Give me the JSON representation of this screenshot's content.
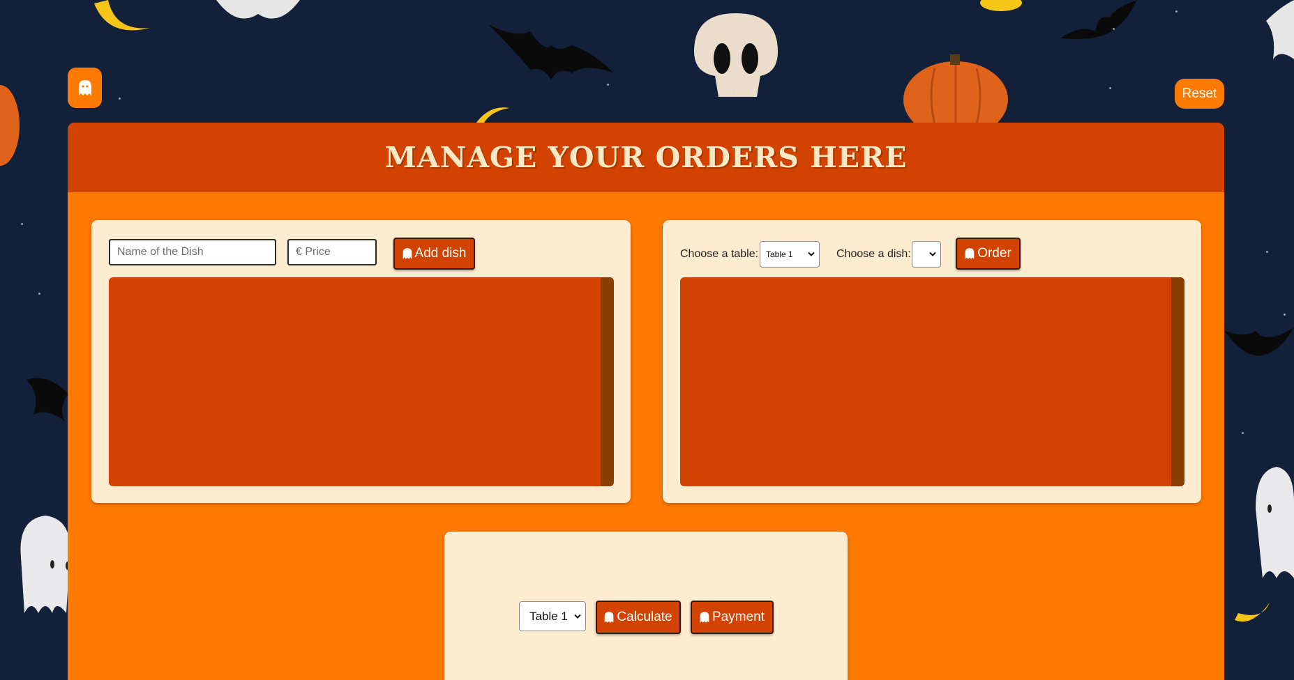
{
  "header": {
    "title": "MANAGE YOUR ORDERS HERE",
    "reset_label": "Reset"
  },
  "menu_form": {
    "dish_name_placeholder": "Name of the Dish",
    "price_placeholder": "€ Price",
    "add_label": "Add dish"
  },
  "order_form": {
    "table_label": "Choose a table:",
    "table_selected": "Table 1",
    "dish_label": "Choose a dish:",
    "dish_selected": "",
    "order_label": "Order"
  },
  "bill": {
    "table_selected": "Table 1",
    "calculate_label": "Calculate",
    "payment_label": "Payment"
  },
  "colors": {
    "accent": "#ff7a00",
    "header_bg": "#d24200",
    "panel_bg": "#fdecd0",
    "list_bg": "#d24200",
    "scrollbar": "#8a3f00",
    "background": "#12203a"
  },
  "icons": [
    "ghost-icon",
    "chevron-down-icon"
  ]
}
